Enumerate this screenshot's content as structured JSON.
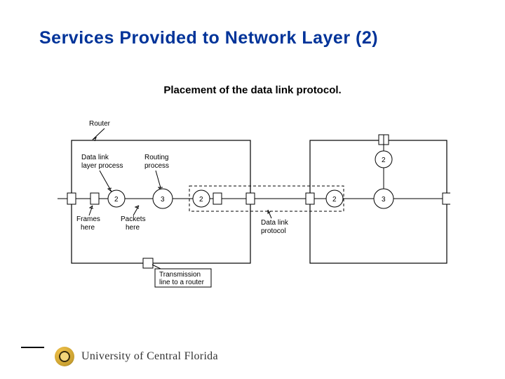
{
  "title": "Services Provided to Network Layer (2)",
  "subtitle": "Placement of the data link protocol.",
  "labels": {
    "router": "Router",
    "dll_process_l1": "Data link",
    "dll_process_l2": "layer process",
    "routing_l1": "Routing",
    "routing_l2": "process",
    "frames_l1": "Frames",
    "frames_l2": "here",
    "packets_l1": "Packets",
    "packets_l2": "here",
    "trans_l1": "Transmission",
    "trans_l2": "line to a router",
    "dlp_l1": "Data link",
    "dlp_l2": "protocol"
  },
  "nodes": {
    "n2": "2",
    "n3": "3"
  },
  "footer": {
    "university": "University of Central Florida"
  }
}
